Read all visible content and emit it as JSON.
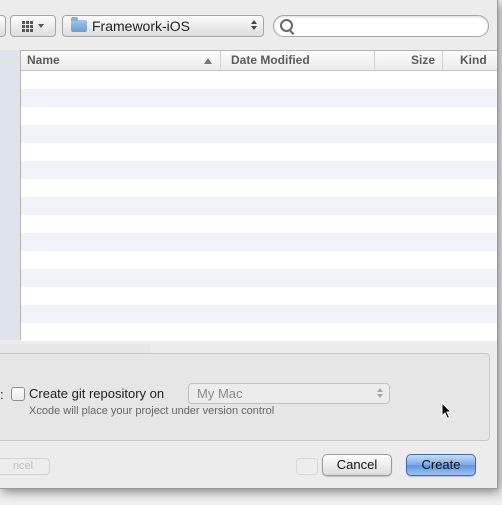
{
  "toolbar": {
    "path_label": "Framework-iOS",
    "search_placeholder": ""
  },
  "columns": [
    {
      "label": "Name",
      "sorted": "ascending"
    },
    {
      "label": "Date Modified"
    },
    {
      "label": "Size"
    },
    {
      "label": "Kind"
    }
  ],
  "options": {
    "leading_colon": ":",
    "git_checkbox_label": "Create git repository on",
    "git_checked": false,
    "location_popup_value": "My Mac",
    "version_control_note": "Xcode will place your project under version control"
  },
  "buttons": {
    "cancel": "Cancel",
    "create": "Create"
  },
  "background": {
    "ghost_cancel": "ncel"
  }
}
